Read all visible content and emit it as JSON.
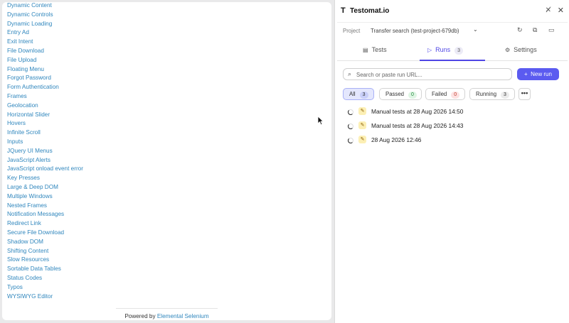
{
  "page": {
    "links": [
      "Dynamic Content",
      "Dynamic Controls",
      "Dynamic Loading",
      "Entry Ad",
      "Exit Intent",
      "File Download",
      "File Upload",
      "Floating Menu",
      "Forgot Password",
      "Form Authentication",
      "Frames",
      "Geolocation",
      "Horizontal Slider",
      "Hovers",
      "Infinite Scroll",
      "Inputs",
      "JQuery UI Menus",
      "JavaScript Alerts",
      "JavaScript onload event error",
      "Key Presses",
      "Large & Deep DOM",
      "Multiple Windows",
      "Nested Frames",
      "Notification Messages",
      "Redirect Link",
      "Secure File Download",
      "Shadow DOM",
      "Shifting Content",
      "Slow Resources",
      "Sortable Data Tables",
      "Status Codes",
      "Typos",
      "WYSIWYG Editor"
    ],
    "footer_prefix": "Powered by",
    "footer_link": "Elemental Selenium"
  },
  "extension": {
    "title": "Testomat.io",
    "project_label": "Project",
    "project_name": "Transfer search (test-project-679db)",
    "tabs": [
      {
        "label": "Tests",
        "icon": "file-icon"
      },
      {
        "label": "Runs",
        "icon": "play-icon",
        "count": "3"
      },
      {
        "label": "Settings",
        "icon": "gear-icon"
      }
    ],
    "search_placeholder": "Search or paste run URL...",
    "new_run_label": "New run",
    "filters": [
      {
        "label": "All",
        "count": "3"
      },
      {
        "label": "Passed",
        "count": "0"
      },
      {
        "label": "Failed",
        "count": "0"
      },
      {
        "label": "Running",
        "count": "3"
      }
    ],
    "more_label": "•••",
    "runs": [
      {
        "title": "Manual tests at 28 Aug 2026 14:50"
      },
      {
        "title": "Manual tests at 28 Aug 2026 14:43"
      },
      {
        "title": "28 Aug 2026 12:46"
      }
    ]
  },
  "colors": {
    "accent": "#5b5bf0",
    "link": "#2f86bd",
    "passed_badge_bg": "#dff5e4",
    "passed_badge_fg": "#1d8a3a",
    "failed_badge_bg": "#fde2e2",
    "failed_badge_fg": "#c0392b"
  }
}
